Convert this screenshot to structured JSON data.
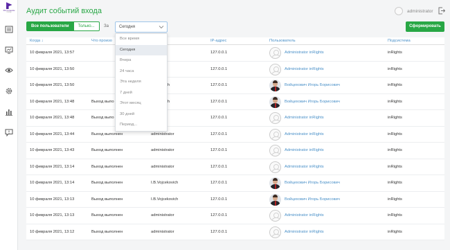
{
  "sidebar": {
    "logo": {
      "line1": "Ростелеком",
      "line2": "Солар"
    },
    "items": [
      {
        "icon": "journal-icon"
      },
      {
        "icon": "monitor-icon"
      },
      {
        "icon": "eye-icon"
      },
      {
        "icon": "gear-icon"
      },
      {
        "icon": "bar-chart-icon"
      },
      {
        "icon": "chat-icon"
      }
    ]
  },
  "header": {
    "title": "Аудит событий входа",
    "user_name": "administrator"
  },
  "filters": {
    "all_users_label": "Все пользователи",
    "only_label": "Только...",
    "period_label": "За",
    "period_value": "Сегодня",
    "period_options": [
      "Все время",
      "Сегодня",
      "Вчера",
      "24 часа",
      "Эта неделя",
      "7 дней",
      "Этот месяц",
      "30 дней",
      "Период..."
    ],
    "selected_option_index": 1,
    "generate_label": "Сформировать"
  },
  "table": {
    "columns": [
      "Когда",
      "Что произо",
      "",
      "IP-адрес",
      "Пользователь",
      "Подсистема"
    ],
    "sort_indicator": "↓",
    "rows": [
      {
        "when": "10 февраля 2021, 13:57",
        "what": "",
        "login": "istrator",
        "ip": "127.0.0.1",
        "user": "Administrator inRights",
        "photo": false,
        "system": "inRights"
      },
      {
        "when": "10 февраля 2021, 13:50",
        "what": "",
        "login": "istrator",
        "ip": "127.0.0.1",
        "user": "Administrator inRights",
        "photo": false,
        "system": "inRights"
      },
      {
        "when": "10 февраля 2021, 13:50",
        "what": "",
        "login": "ojcekovich",
        "ip": "127.0.0.1",
        "user": "Войцехович Игорь Борисович",
        "photo": true,
        "system": "inRights"
      },
      {
        "when": "10 февраля 2021, 13:48",
        "what": "Выход выпо",
        "login": "ojcekovich",
        "ip": "127.0.0.1",
        "user": "Войцехович Игорь Борисович",
        "photo": true,
        "system": "inRights"
      },
      {
        "when": "10 февраля 2021, 13:48",
        "what": "Выход выпо",
        "login": "istrator",
        "ip": "127.0.0.1",
        "user": "Administrator inRights",
        "photo": false,
        "system": "inRights"
      },
      {
        "when": "10 февраля 2021, 13:44",
        "what": "Выход выполнен",
        "login": "administrator",
        "ip": "127.0.0.1",
        "user": "Administrator inRights",
        "photo": false,
        "system": "inRights"
      },
      {
        "when": "10 февраля 2021, 13:43",
        "what": "Выход выполнен",
        "login": "administrator",
        "ip": "127.0.0.1",
        "user": "Administrator inRights",
        "photo": false,
        "system": "inRights"
      },
      {
        "when": "10 февраля 2021, 13:14",
        "what": "Выход выполнен",
        "login": "administrator",
        "ip": "127.0.0.1",
        "user": "Administrator inRights",
        "photo": false,
        "system": "inRights"
      },
      {
        "when": "10 февраля 2021, 13:14",
        "what": "Выход выполнен",
        "login": "I.B.Vojcekovich",
        "ip": "127.0.0.1",
        "user": "Войцехович Игорь Борисович",
        "photo": true,
        "system": "inRights"
      },
      {
        "when": "10 февраля 2021, 13:13",
        "what": "Выход выполнен",
        "login": "I.B.Vojcekovich",
        "ip": "127.0.0.1",
        "user": "Войцехович Игорь Борисович",
        "photo": true,
        "system": "inRights"
      },
      {
        "when": "10 февраля 2021, 13:13",
        "what": "Выход выполнен",
        "login": "administrator",
        "ip": "127.0.0.1",
        "user": "Administrator inRights",
        "photo": false,
        "system": "inRights"
      },
      {
        "when": "10 февраля 2021, 13:12",
        "what": "Выход выполнен",
        "login": "administrator",
        "ip": "127.0.0.1",
        "user": "Administrator inRights",
        "photo": false,
        "system": "inRights"
      }
    ]
  },
  "colors": {
    "accent": "#28a745",
    "link": "#4a90c8"
  }
}
